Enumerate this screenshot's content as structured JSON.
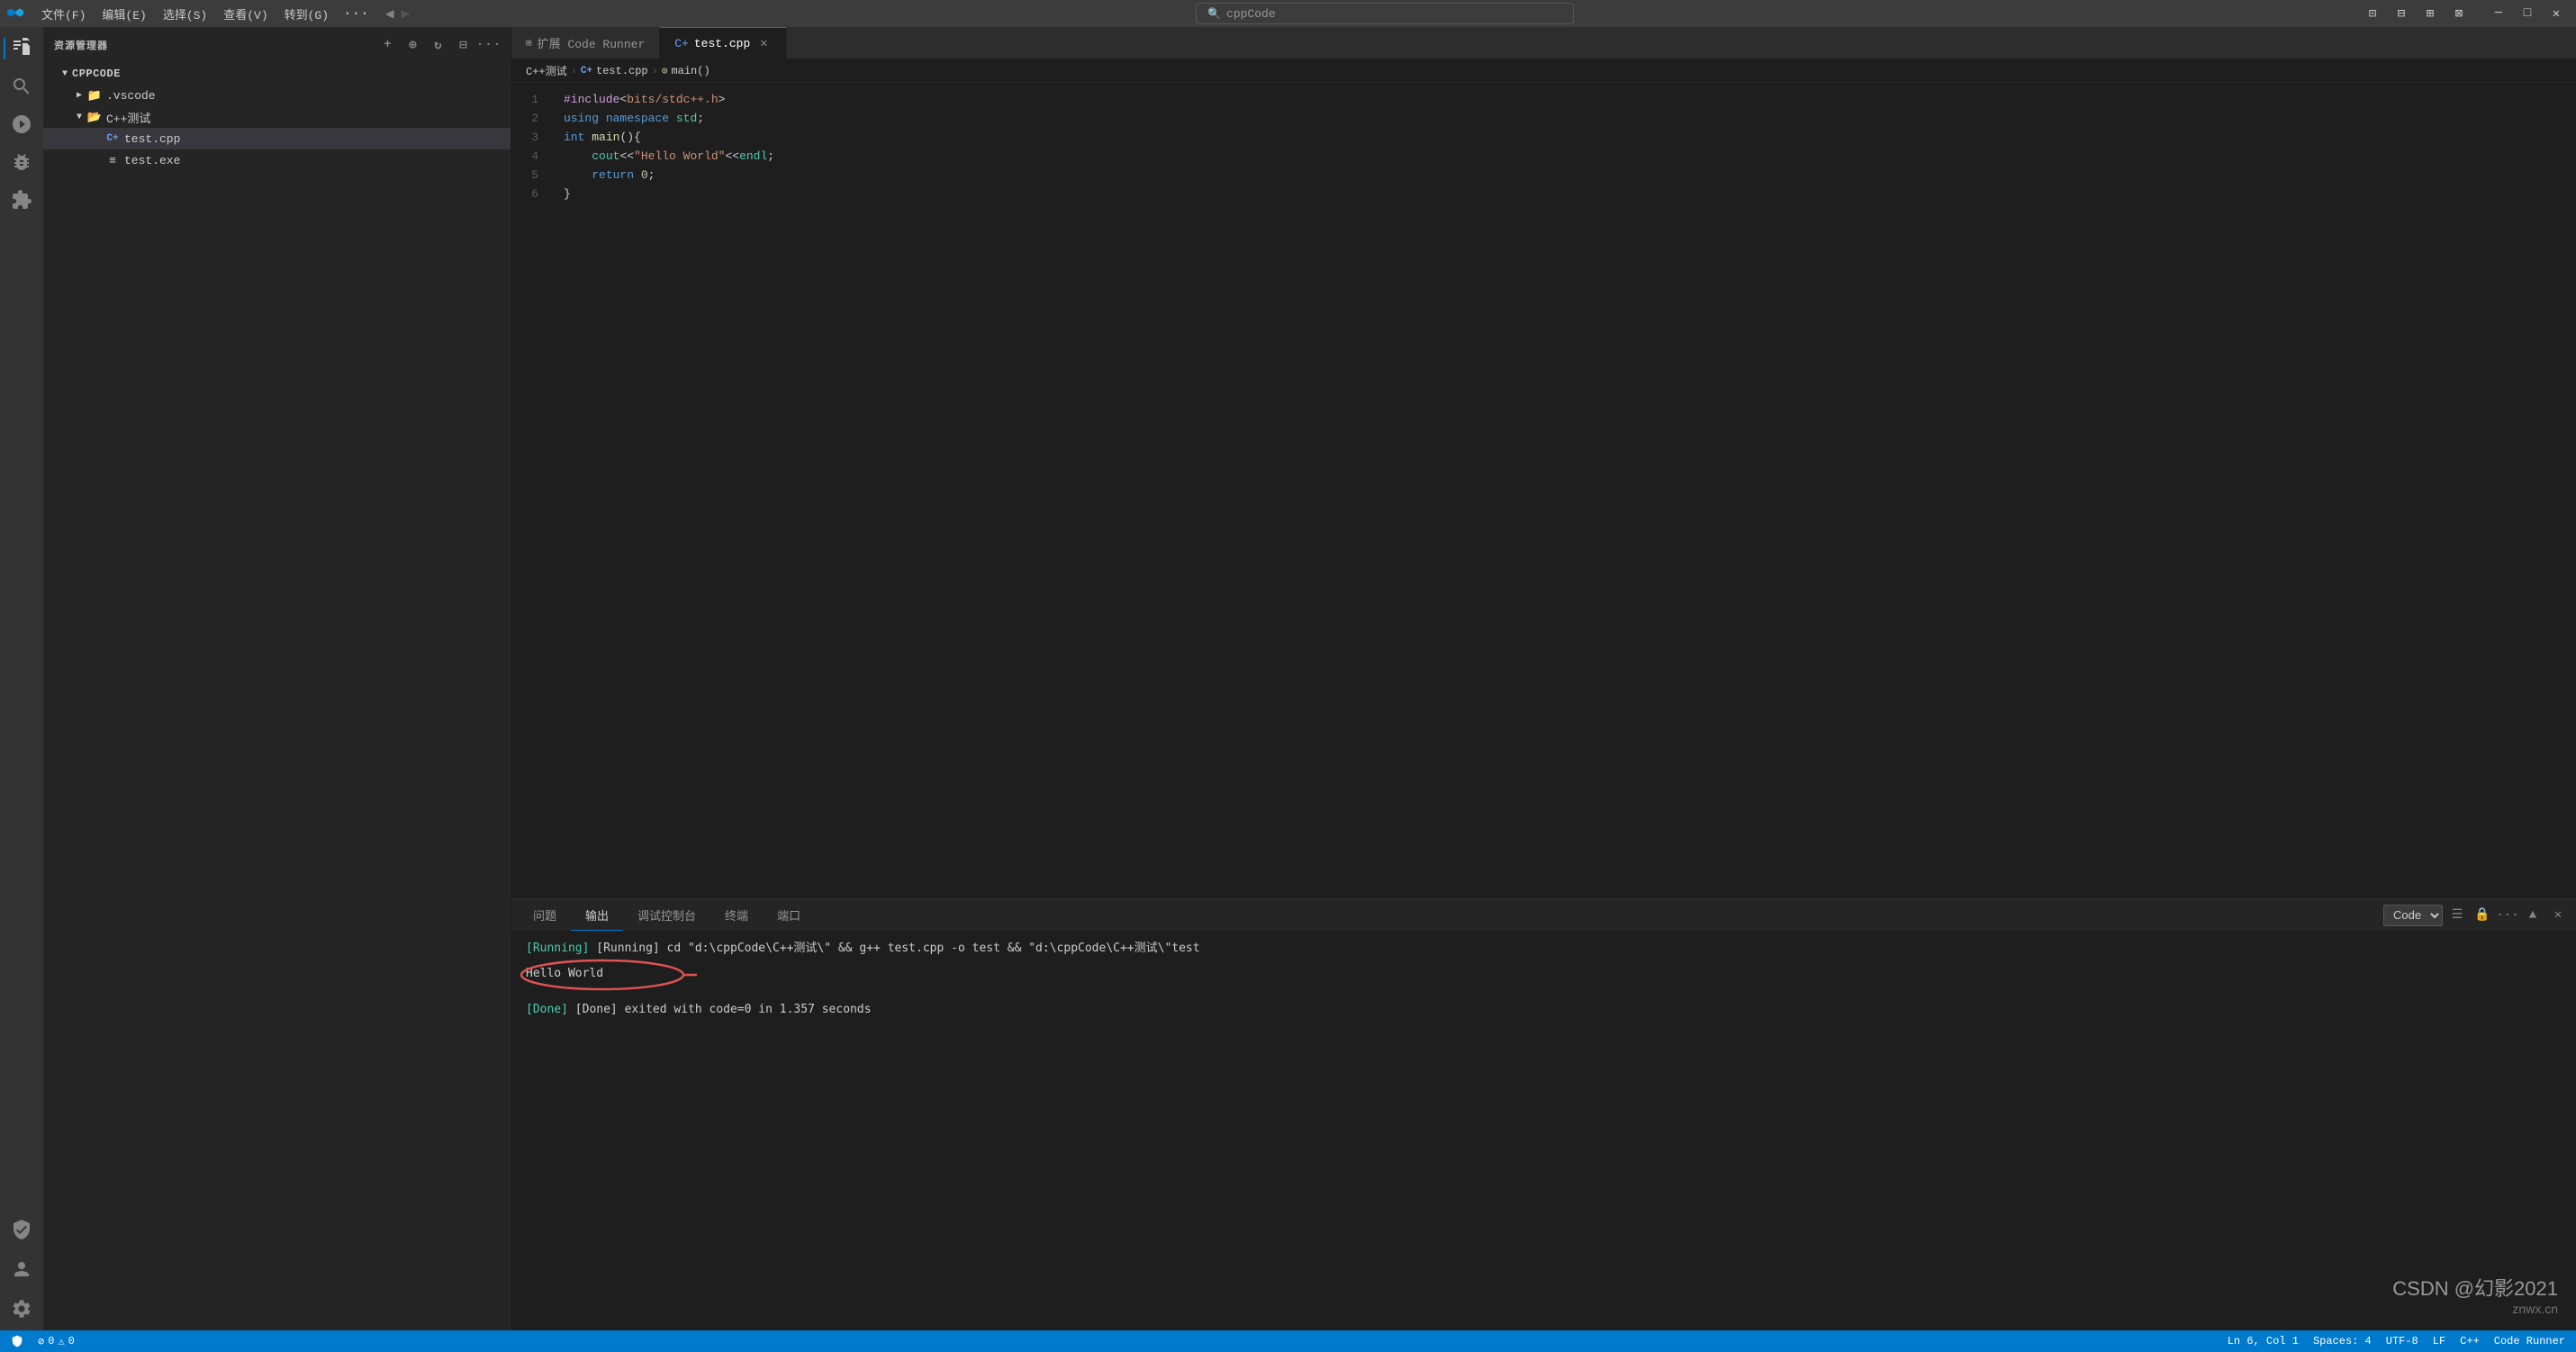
{
  "titleBar": {
    "logo": "✦",
    "menus": [
      "文件(F)",
      "编辑(E)",
      "选择(S)",
      "查看(V)",
      "转到(G)",
      "···"
    ],
    "search": "cppCode",
    "searchPlaceholder": "cppCode",
    "controls": {
      "layout1": "▣",
      "layout2": "▤",
      "layout3": "▥",
      "layout4": "⊞",
      "minimize": "─",
      "maximize": "□",
      "close": "✕"
    }
  },
  "activityBar": {
    "icons": [
      {
        "name": "explorer-icon",
        "symbol": "⧉",
        "active": true
      },
      {
        "name": "search-icon",
        "symbol": "🔍",
        "active": false
      },
      {
        "name": "source-control-icon",
        "symbol": "⑂",
        "active": false
      },
      {
        "name": "debug-icon",
        "symbol": "▷",
        "active": false
      },
      {
        "name": "extensions-icon",
        "symbol": "⊞",
        "active": false
      },
      {
        "name": "remote-icon",
        "symbol": "⚙",
        "active": false
      }
    ],
    "bottomIcons": [
      {
        "name": "account-icon",
        "symbol": "👤"
      },
      {
        "name": "settings-icon",
        "symbol": "⚙"
      }
    ]
  },
  "sidebar": {
    "title": "资源管理器",
    "rootLabel": "CPPCODE",
    "items": [
      {
        "type": "folder",
        "label": ".vscode",
        "indent": 1,
        "expanded": false
      },
      {
        "type": "folder",
        "label": "C++测试",
        "indent": 1,
        "expanded": true
      },
      {
        "type": "file",
        "label": "test.cpp",
        "indent": 2,
        "active": true,
        "icon": "C+"
      },
      {
        "type": "file",
        "label": "test.exe",
        "indent": 2,
        "active": false,
        "icon": "≡"
      }
    ]
  },
  "tabs": {
    "extensionTab": {
      "icon": "⊞",
      "label": "扩展 Code Runner"
    },
    "fileTab": {
      "icon": "C+",
      "label": "test.cpp",
      "active": true
    }
  },
  "breadcrumb": {
    "items": [
      "C++测试",
      "test.cpp",
      "main()"
    ]
  },
  "editor": {
    "lines": [
      {
        "num": 1,
        "code": "#include<bits/stdc++.h>"
      },
      {
        "num": 2,
        "code": "using namespace std;"
      },
      {
        "num": 3,
        "code": "int main(){"
      },
      {
        "num": 4,
        "code": "    cout<<\"Hello World\"<<endl;"
      },
      {
        "num": 5,
        "code": "    return 0;"
      },
      {
        "num": 6,
        "code": "}"
      }
    ]
  },
  "panel": {
    "tabs": [
      "问题",
      "输出",
      "调试控制台",
      "终端",
      "端口"
    ],
    "activeTab": "输出",
    "dropdownValue": "Code",
    "output": {
      "runningCmd": "[Running] cd \"d:\\cppCode\\C++测试\\\" && g++ test.cpp -o test && \"d:\\cppCode\\C++测试\\\"test",
      "helloWorld": "Hello World",
      "doneMsg": "[Done] exited with code=0 in 1.357 seconds"
    }
  },
  "statusBar": {
    "left": [
      "⚙",
      "0 △ 0",
      "◎"
    ],
    "right": [
      "Ln 6, Col 1",
      "Spaces: 4",
      "UTF-8",
      "LF",
      "C++",
      "Code Runner"
    ]
  },
  "watermark": {
    "line1": "CSDN @幻影2021",
    "line2": "znwx.cn"
  }
}
